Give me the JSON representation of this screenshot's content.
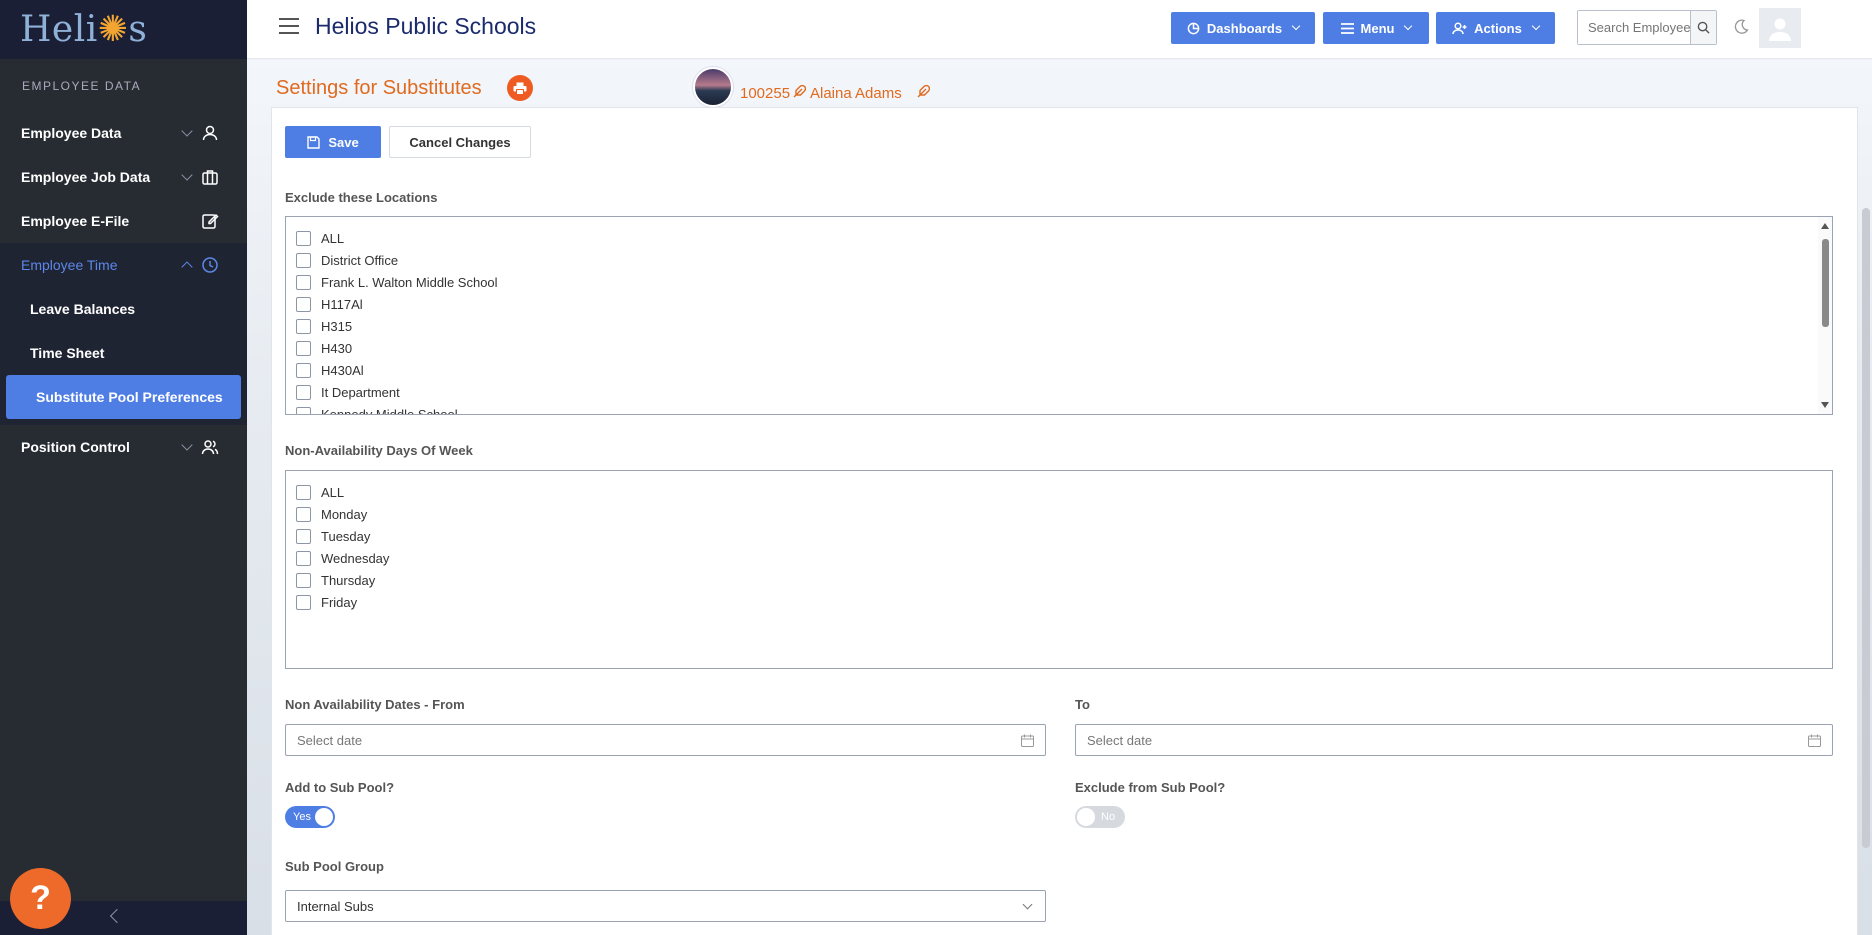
{
  "sidebar": {
    "logo": "Helios",
    "section_title": "EMPLOYEE DATA",
    "items": [
      {
        "label": "Employee Data"
      },
      {
        "label": "Employee Job Data"
      },
      {
        "label": "Employee E-File"
      },
      {
        "label": "Employee Time"
      },
      {
        "label": "Position Control"
      }
    ],
    "sub_items": [
      {
        "label": "Leave Balances"
      },
      {
        "label": "Time Sheet"
      },
      {
        "label": "Substitute Pool Preferences"
      }
    ],
    "help_label": "?"
  },
  "header": {
    "title": "Helios Public Schools",
    "dashboards_label": "Dashboards",
    "menu_label": "Menu",
    "actions_label": "Actions",
    "search_placeholder": "Search Employee..."
  },
  "page": {
    "title": "Settings for Substitutes",
    "employee_id": "100255",
    "employee_name": "Alaina Adams"
  },
  "form": {
    "save_label": "Save",
    "cancel_label": "Cancel Changes",
    "locations_label": "Exclude these Locations",
    "locations": [
      "ALL",
      "District Office",
      "Frank L. Walton Middle School",
      "H117Al",
      "H315",
      "H430",
      "H430Al",
      "It Department",
      "Kennedy Middle School"
    ],
    "days_label": "Non-Availability Days Of Week",
    "days": [
      "ALL",
      "Monday",
      "Tuesday",
      "Wednesday",
      "Thursday",
      "Friday"
    ],
    "dates_from_label": "Non Availability Dates - From",
    "dates_to_label": "To",
    "date_placeholder": "Select date",
    "add_sub_pool_label": "Add to Sub Pool?",
    "add_sub_pool_value": "Yes",
    "exclude_sub_pool_label": "Exclude from Sub Pool?",
    "exclude_sub_pool_value": "No",
    "sub_pool_group_label": "Sub Pool Group",
    "sub_pool_group_value": "Internal Subs"
  },
  "colors": {
    "accent": "#4e7ee4",
    "orange": "#e06a1f",
    "sidebar": "#272c33"
  }
}
